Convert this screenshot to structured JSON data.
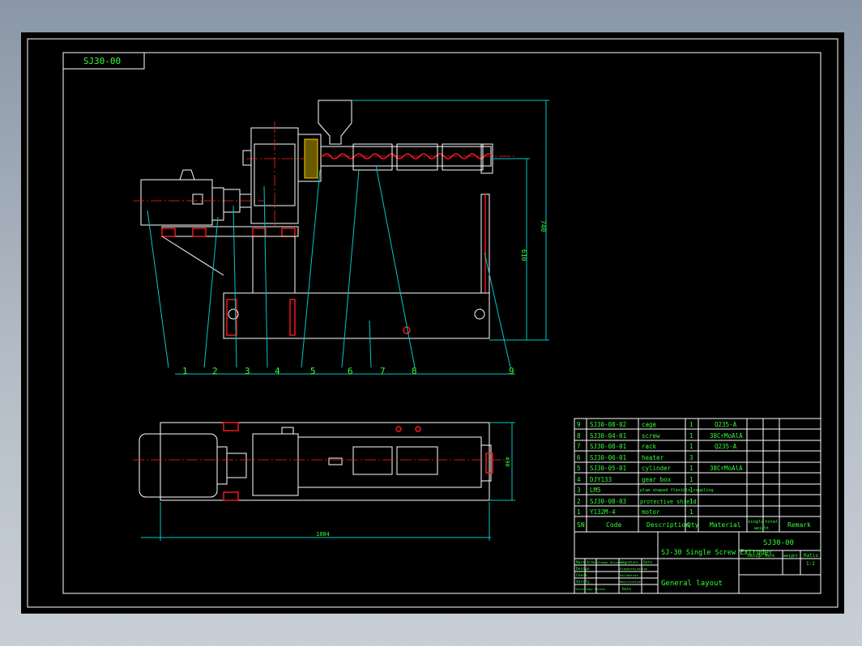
{
  "drawing": {
    "code_box": "SJ30-00",
    "title": "SJ-30 Single Screw Extruder",
    "subtitle": "General layout",
    "drawing_no": "SJ30-00",
    "ratio_label": "Ratio",
    "ratio_value": "1:2",
    "design_mark_label": "Design Mark",
    "weight_label": "weight"
  },
  "callouts": [
    "1",
    "2",
    "3",
    "4",
    "5",
    "6",
    "7",
    "8",
    "9"
  ],
  "dimensions": {
    "total_height": "740",
    "frame_height": "610",
    "plan_length": "1884",
    "plan_width": "490"
  },
  "bom": {
    "headers": {
      "sn": "SN",
      "code": "Code",
      "description": "Description",
      "qty": "Qty",
      "material": "Material",
      "single": "single",
      "total": "total",
      "weight": "weight",
      "remark": "Remark"
    },
    "rows": [
      {
        "sn": "9",
        "code": "SJ30-08-02",
        "description": "cage",
        "qty": "1",
        "material": "Q235-A"
      },
      {
        "sn": "8",
        "code": "SJ30-04-01",
        "description": "screw",
        "qty": "1",
        "material": "38CrMoAlA"
      },
      {
        "sn": "7",
        "code": "SJ30-08-01",
        "description": "rack",
        "qty": "1",
        "material": "Q235-A"
      },
      {
        "sn": "6",
        "code": "SJ30-06-01",
        "description": "heater",
        "qty": "3",
        "material": ""
      },
      {
        "sn": "5",
        "code": "SJ30-05-01",
        "description": "cylinder",
        "qty": "1",
        "material": "38CrMoAlA"
      },
      {
        "sn": "4",
        "code": "DJY133",
        "description": "gear box",
        "qty": "1",
        "material": ""
      },
      {
        "sn": "3",
        "code": "LM5",
        "description": "plum shaped flexible coupling",
        "qty": "1",
        "material": ""
      },
      {
        "sn": "2",
        "code": "SJ30-08-03",
        "description": "protective shield",
        "qty": "1",
        "material": ""
      },
      {
        "sn": "1",
        "code": "Y132M-4",
        "description": "motor",
        "qty": "1",
        "material": ""
      }
    ]
  },
  "signoff": {
    "headers": [
      "Mark",
      "Area",
      "Change Document",
      "Signature",
      "Date"
    ],
    "rows": [
      [
        "Design",
        "",
        "Standardization",
        "",
        ""
      ],
      [
        "Check",
        "",
        "Validation",
        "",
        ""
      ],
      [
        "Verify",
        "",
        "Ratification",
        "",
        ""
      ],
      [
        "Technology Review",
        "",
        "Date",
        "",
        ""
      ]
    ]
  },
  "colors": {
    "frame": "#00c8c8",
    "text": "#33ff33",
    "outline": "#ffffff",
    "hidden": "#ff1a1a"
  }
}
